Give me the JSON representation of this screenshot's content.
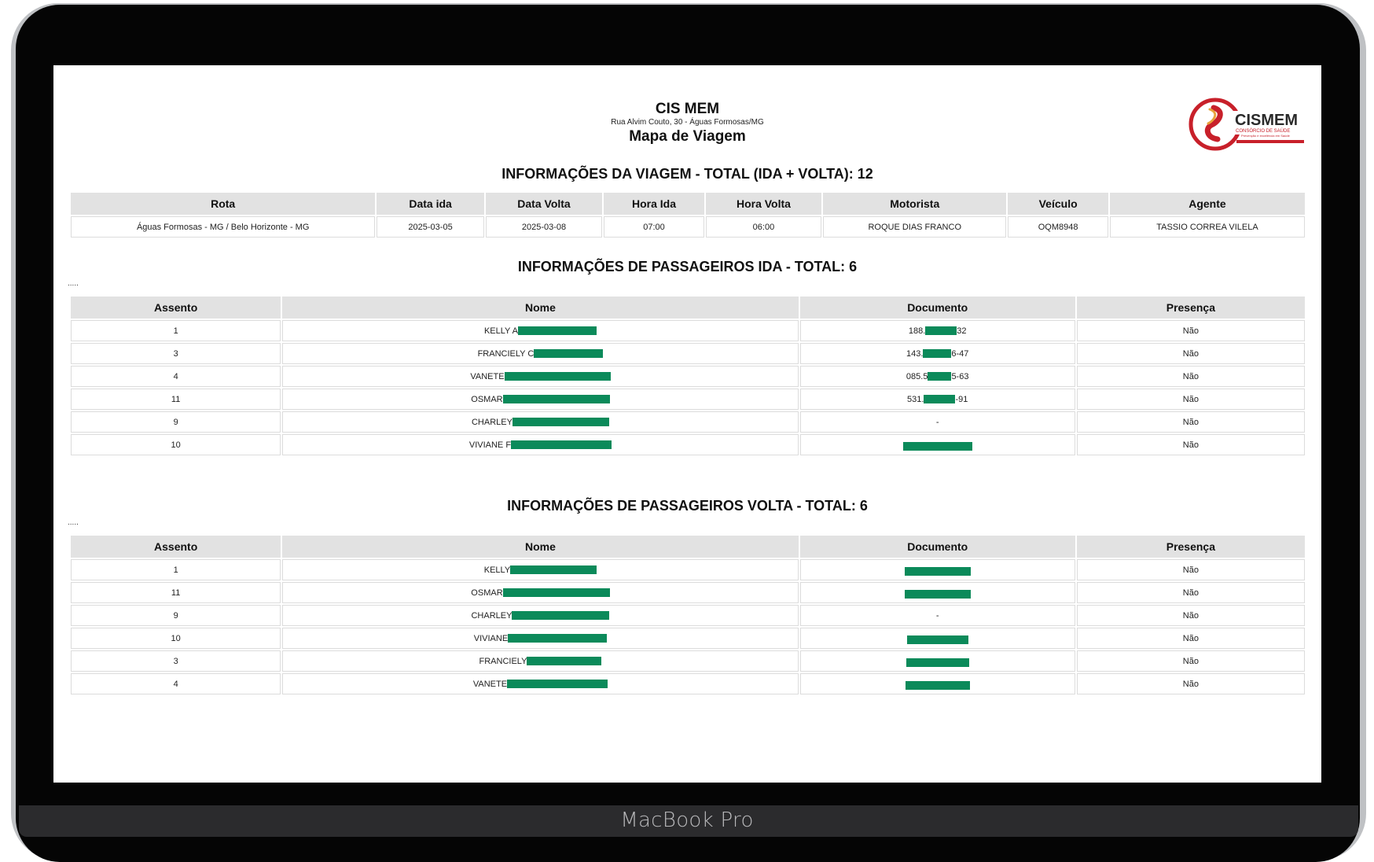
{
  "device": {
    "brand_label": "MacBook Pro"
  },
  "report": {
    "company": "CIS MEM",
    "address": "Rua Alvim Couto, 30 - Águas Formosas/MG",
    "title": "Mapa de Viagem",
    "logo": {
      "text": "CISMEM",
      "subtext": "CONSÓRCIO DE SAÚDE",
      "tagline": "Prevenção e excelência em Saúde",
      "accent_color": "#c8202a"
    }
  },
  "trip_section": {
    "title": "INFORMAÇÕES DA VIAGEM - TOTAL (IDA + VOLTA): 12",
    "headers": [
      "Rota",
      "Data ida",
      "Data Volta",
      "Hora Ida",
      "Hora Volta",
      "Motorista",
      "Veículo",
      "Agente"
    ],
    "row": [
      "Águas Formosas - MG / Belo Horizonte - MG",
      "2025-03-05",
      "2025-03-08",
      "07:00",
      "06:00",
      "ROQUE DIAS FRANCO",
      "OQM8948",
      "TASSIO CORREA VILELA"
    ]
  },
  "ida_section": {
    "title": "INFORMAÇÕES DE PASSAGEIROS IDA - TOTAL: 6",
    "dots": ".....",
    "headers": [
      "Assento",
      "Nome",
      "Documento",
      "Presença"
    ],
    "rows": [
      {
        "seat": "1",
        "name": "KELLY A",
        "doc_prefix": "188.",
        "doc_suffix": "32",
        "presence": "Não"
      },
      {
        "seat": "3",
        "name": "FRANCIELY C",
        "doc_prefix": "143.",
        "doc_suffix": "6-47",
        "presence": "Não"
      },
      {
        "seat": "4",
        "name": "VANETE",
        "doc_prefix": "085.5",
        "doc_suffix": "5-63",
        "presence": "Não"
      },
      {
        "seat": "11",
        "name": "OSMAR",
        "doc_prefix": "531.",
        "doc_suffix": "-91",
        "presence": "Não"
      },
      {
        "seat": "9",
        "name": "CHARLEY",
        "doc_prefix": "-",
        "doc_suffix": "",
        "presence": "Não"
      },
      {
        "seat": "10",
        "name": "VIVIANE F",
        "doc_prefix": "",
        "doc_suffix": "",
        "presence": "Não"
      }
    ]
  },
  "volta_section": {
    "title": "INFORMAÇÕES DE PASSAGEIROS VOLTA - TOTAL: 6",
    "dots": ".....",
    "headers": [
      "Assento",
      "Nome",
      "Documento",
      "Presença"
    ],
    "rows": [
      {
        "seat": "1",
        "name": "KELLY",
        "doc_prefix": "",
        "doc_suffix": "",
        "presence": "Não"
      },
      {
        "seat": "11",
        "name": "OSMAR",
        "doc_prefix": "",
        "doc_suffix": "",
        "presence": "Não"
      },
      {
        "seat": "9",
        "name": "CHARLEY",
        "doc_prefix": "-",
        "doc_suffix": "",
        "presence": "Não"
      },
      {
        "seat": "10",
        "name": "VIVIANE",
        "doc_prefix": "",
        "doc_suffix": "",
        "presence": "Não"
      },
      {
        "seat": "3",
        "name": "FRANCIELY",
        "doc_prefix": "",
        "doc_suffix": "",
        "presence": "Não"
      },
      {
        "seat": "4",
        "name": "VANETE",
        "doc_prefix": "",
        "doc_suffix": "",
        "presence": "Não"
      }
    ]
  },
  "redaction_color": "#0b8a5a"
}
